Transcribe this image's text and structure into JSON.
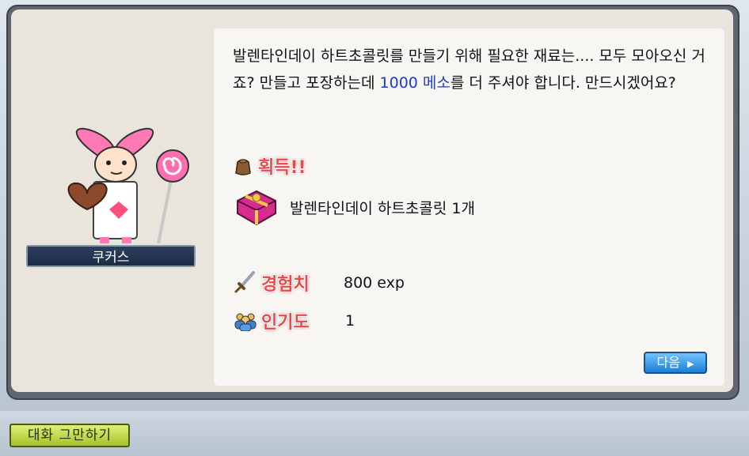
{
  "npc": {
    "name": "쿠커스"
  },
  "dialog": {
    "text_before": "발렌타인데이 하트초콜릿를 만들기 위해 필요한 재료는.... 모두 모아오신 거죠? 만들고 포장하는데 ",
    "highlight": "1000 메소",
    "text_after": "를 더 주셔야 합니다. 만드시겠어요?"
  },
  "rewards": {
    "acquire_title": "획득!!",
    "item_label": "발렌타인데이 하트초콜릿 1개",
    "exp_title": "경험치",
    "exp_value": "800 exp",
    "fame_title": "인기도",
    "fame_value": "1"
  },
  "buttons": {
    "next_label": "다음",
    "end_chat_label": "대화 그만하기"
  },
  "colors": {
    "highlight": "#1a3ccf",
    "reward_title": "#e84a4a",
    "next_button": "#1d7fd6",
    "end_chat_button": "#a5c22a"
  }
}
